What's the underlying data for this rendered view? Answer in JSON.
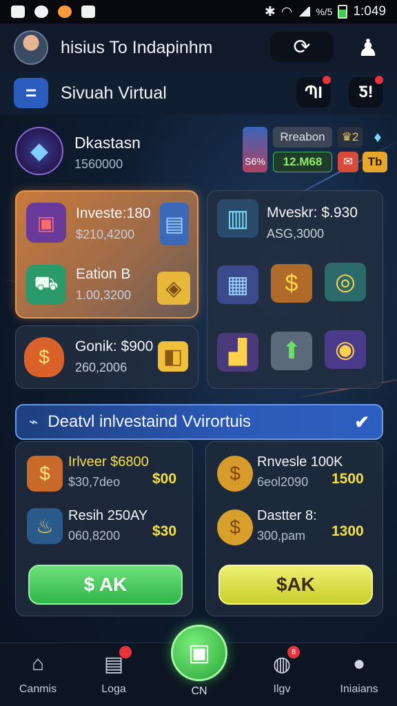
{
  "status_bar": {
    "time": "1:049",
    "battery_text": "%/5"
  },
  "header": {
    "username": "hisius To Indapinhm",
    "title": "Sivuah Virtual",
    "btn_a": "ՊI",
    "btn_b": "Ƽ!"
  },
  "profile": {
    "name": "Dkastasn",
    "value": "1560000",
    "chips": {
      "side_pct": "S6%",
      "rank": "Rreabon",
      "gold": "2",
      "money": "12.M68",
      "badge": "Tb"
    }
  },
  "left_panel": {
    "item1": {
      "label": "Investe:180",
      "value": "$210,4200"
    },
    "item2": {
      "label": "Eation B",
      "value": "1.00,3200"
    },
    "item3": {
      "label": "Gonik: $900",
      "value": "260,2006"
    }
  },
  "right_panel": {
    "label": "Mveskr: $.930",
    "value": "ASG,3000"
  },
  "banner": {
    "text": "Deatvl inlvestaind Vvirortuis"
  },
  "cards": {
    "left": {
      "row1": {
        "label": "Irlveer $6800",
        "sub": "$30,7deo",
        "amount": "$00"
      },
      "row2": {
        "label": "Resih 250AY",
        "sub": "060,8200",
        "amount": "$30"
      },
      "cta": "$ AK"
    },
    "right": {
      "row1": {
        "label": "Rnvesle 100K",
        "sub": "6eol2090",
        "amount": "1500"
      },
      "row2": {
        "label": "Dastter 8:",
        "sub": "300,pam",
        "amount": "1300"
      },
      "cta": "$AK"
    }
  },
  "nav": {
    "items": [
      {
        "label": "Canmis",
        "icon": "home-icon"
      },
      {
        "label": "Loga",
        "icon": "store-icon",
        "badge": ""
      },
      {
        "label": "CN",
        "icon": "document-icon"
      },
      {
        "label": "Ilgv",
        "icon": "gift-icon",
        "badge": "8"
      },
      {
        "label": "Iniaians",
        "icon": "user-icon"
      }
    ]
  },
  "colors": {
    "accent_blue": "#2a5dbd",
    "accent_green": "#2fb548",
    "accent_yellow": "#c9cf2a",
    "gold_text": "#f4e04a"
  }
}
